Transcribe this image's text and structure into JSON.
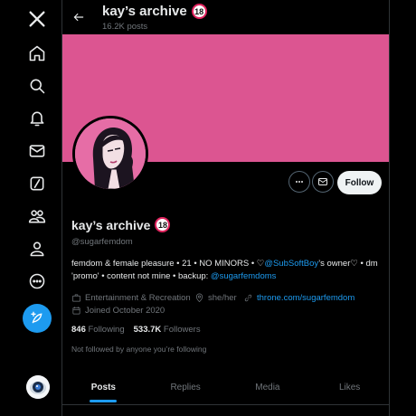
{
  "nav": {
    "items": [
      {
        "icon": "x-logo-icon"
      },
      {
        "icon": "home-icon"
      },
      {
        "icon": "search-icon"
      },
      {
        "icon": "notifications-bell-icon"
      },
      {
        "icon": "messages-envelope-icon"
      },
      {
        "icon": "grok-icon"
      },
      {
        "icon": "communities-icon"
      },
      {
        "icon": "profile-icon"
      },
      {
        "icon": "more-icon"
      }
    ],
    "post_icon": "feather-plus-icon"
  },
  "header": {
    "title": "kay’s archive",
    "badge": "18",
    "posts_count": "16.2K posts"
  },
  "profile": {
    "banner_color": "#dc5591",
    "name": "kay’s archive",
    "badge": "18",
    "handle": "@sugarfemdom",
    "bio": {
      "part1": "femdom & female pleasure • 21 • NO MINORS • ♡",
      "mention": "@SubSoftBoy",
      "part2": "’s owner♡ • dm 'promo' • content not mine • backup: ",
      "backup": "@sugarfemdoms"
    },
    "category": "Entertainment & Recreation",
    "location": "she/her",
    "website": "throne.com/sugarfemdom",
    "joined": "Joined October 2020",
    "following_count": "846",
    "following_label": "Following",
    "followers_count": "533.7K",
    "followers_label": "Followers",
    "not_followed": "Not followed by anyone you’re following"
  },
  "actions": {
    "follow_label": "Follow"
  },
  "tabs": [
    {
      "label": "Posts",
      "active": true
    },
    {
      "label": "Replies",
      "active": false
    },
    {
      "label": "Media",
      "active": false
    },
    {
      "label": "Likes",
      "active": false
    }
  ],
  "colors": {
    "accent": "#1d9bf0",
    "background": "#000000",
    "muted": "#71767b"
  }
}
